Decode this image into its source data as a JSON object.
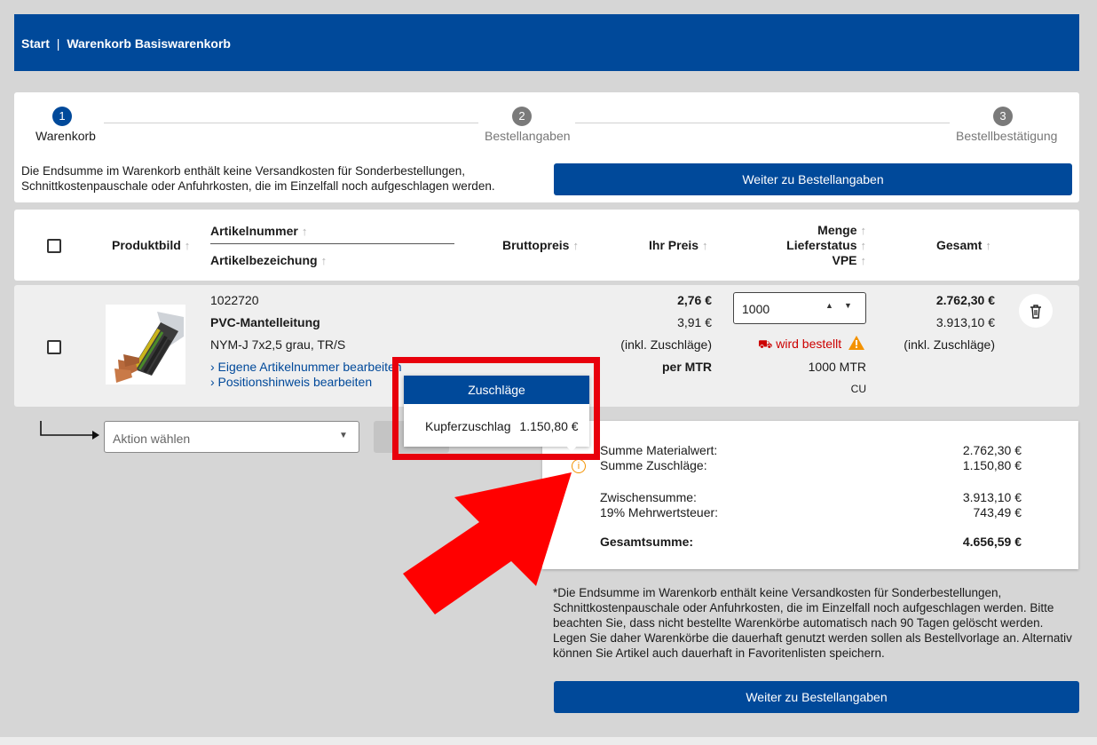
{
  "header": {
    "breadcrumb_start": "Start",
    "breadcrumb_sep": "|",
    "breadcrumb_current": "Warenkorb Basiswarenkorb"
  },
  "steps": [
    {
      "number": "1",
      "label": "Warenkorb",
      "active": true
    },
    {
      "number": "2",
      "label": "Bestellangaben",
      "active": false
    },
    {
      "number": "3",
      "label": "Bestellbestätigung",
      "active": false
    }
  ],
  "notice": "Die Endsumme im Warenkorb enthält keine Versandkosten für Sonderbestellungen, Schnittkostenpauschale oder Anfuhrkosten, die im Einzelfall noch aufgeschlagen werden.",
  "continue_label": "Weiter zu Bestellangaben",
  "columns": {
    "image": "Produktbild",
    "article_no": "Artikelnummer",
    "article_desc": "Artikelbezeichung",
    "gross": "Bruttopreis",
    "your_price": "Ihr Preis",
    "qty": "Menge",
    "delivery": "Lieferstatus",
    "vpe": "VPE",
    "total": "Gesamt"
  },
  "item": {
    "number": "1022720",
    "name": "PVC-Mantelleitung",
    "spec": "NYM-J 7x2,5 grau, TR/S",
    "edit_number_link": "› Eigene Artikelnummer bearbeiten",
    "edit_note_link": "› Positionshinweis bearbeiten",
    "price": "2,76 €",
    "price_incl": "3,91 €",
    "price_note": "(inkl. Zuschläge)",
    "price_unit": "per MTR",
    "quantity": "1000",
    "status": "wird bestellt",
    "vpe_qty": "1000 MTR",
    "vpe_unit": "CU",
    "total": "2.762,30 €",
    "total_incl": "3.913,10 €",
    "total_note": "(inkl. Zuschläge)"
  },
  "action_placeholder": "Aktion wählen",
  "popup": {
    "title": "Zuschläge",
    "line_label": "Kupferzuschlag",
    "line_value": "1.150,80 €"
  },
  "summary": {
    "material_label": "Summe Materialwert:",
    "material_value": "2.762,30 €",
    "surcharge_label": "Summe Zuschläge:",
    "surcharge_value": "1.150,80 €",
    "subtotal_label": "Zwischensumme:",
    "subtotal_value": "3.913,10 €",
    "vat_label": "19% Mehrwertsteuer:",
    "vat_value": "743,49 €",
    "grand_label": "Gesamtsumme:",
    "grand_value": "4.656,59 €"
  },
  "footnote": "*Die Endsumme im Warenkorb enthält keine Versandkosten für Sonderbestellungen, Schnittkostenpauschale oder Anfuhrkosten, die im Einzelfall noch aufgeschlagen werden. Bitte beachten Sie, dass nicht bestellte Warenkörbe automatisch nach 90 Tagen gelöscht werden. Legen Sie daher Warenkörbe die dauerhaft genutzt werden sollen als Bestellvorlage an. Alternativ können Sie Artikel auch dauerhaft in Favoritenlisten speichern.",
  "colors": {
    "brand": "#00499a",
    "alert": "#e8000c",
    "status": "#cc0000",
    "warning": "#f39200"
  },
  "icons": [
    "truck-icon",
    "warning-icon",
    "trash-icon",
    "info-icon",
    "sort-arrow-icon",
    "chevron-down-icon",
    "stepper-icon"
  ]
}
